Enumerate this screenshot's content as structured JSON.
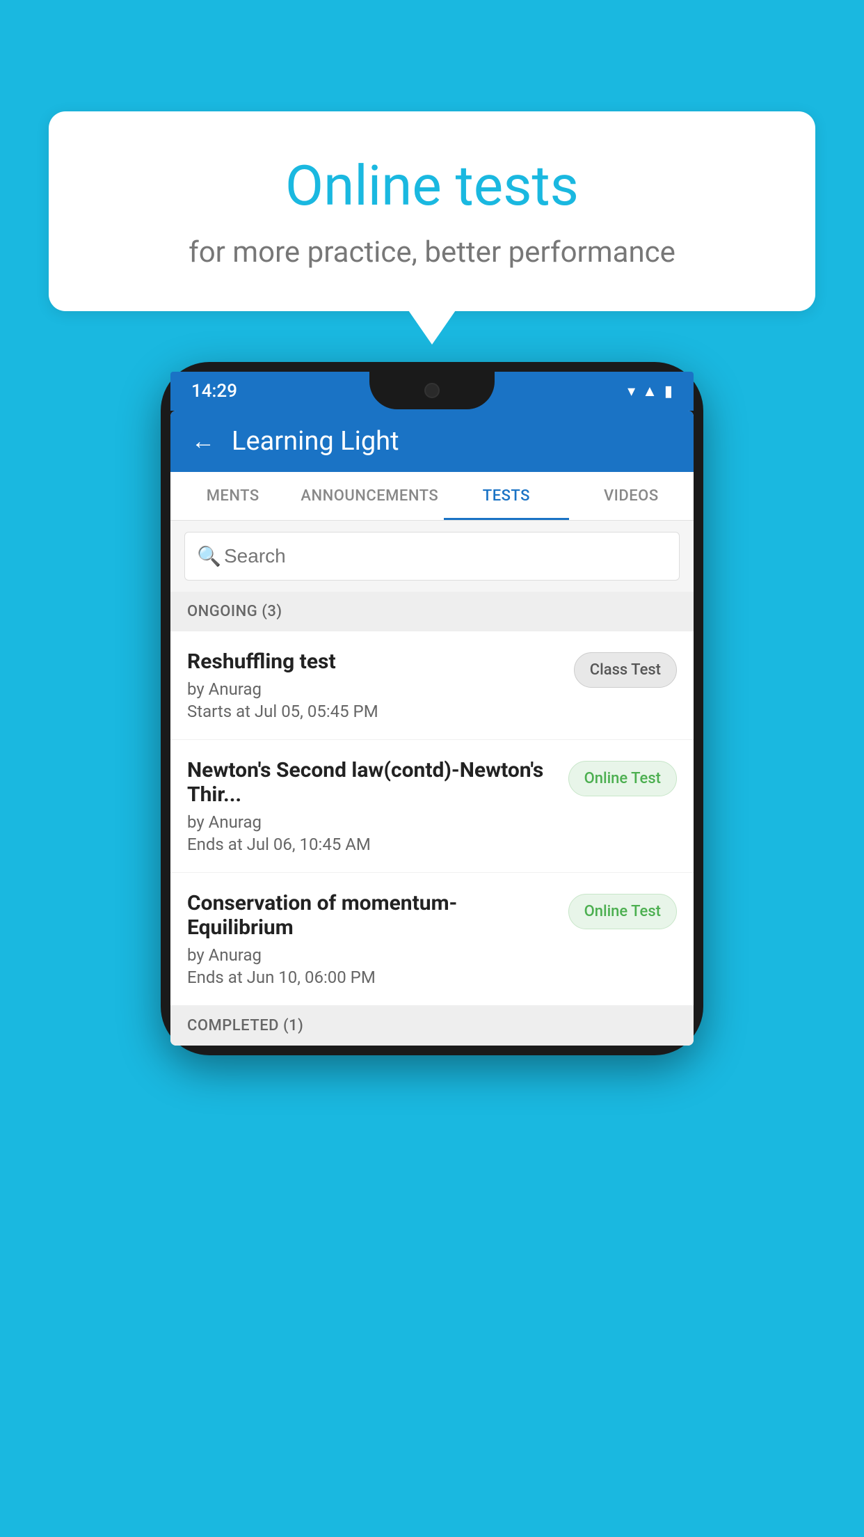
{
  "background": {
    "color": "#1ab8e0"
  },
  "speech_bubble": {
    "title": "Online tests",
    "subtitle": "for more practice, better performance"
  },
  "phone": {
    "status_bar": {
      "time": "14:29"
    },
    "app_header": {
      "title": "Learning Light",
      "back_label": "←"
    },
    "tabs": [
      {
        "label": "MENTS",
        "active": false
      },
      {
        "label": "ANNOUNCEMENTS",
        "active": false
      },
      {
        "label": "TESTS",
        "active": true
      },
      {
        "label": "VIDEOS",
        "active": false
      }
    ],
    "search": {
      "placeholder": "Search"
    },
    "ongoing_section": {
      "header": "ONGOING (3)",
      "tests": [
        {
          "name": "Reshuffling test",
          "by": "by Anurag",
          "time": "Starts at  Jul 05, 05:45 PM",
          "badge": "Class Test",
          "badge_type": "class"
        },
        {
          "name": "Newton's Second law(contd)-Newton's Thir...",
          "by": "by Anurag",
          "time": "Ends at  Jul 06, 10:45 AM",
          "badge": "Online Test",
          "badge_type": "online"
        },
        {
          "name": "Conservation of momentum-Equilibrium",
          "by": "by Anurag",
          "time": "Ends at  Jun 10, 06:00 PM",
          "badge": "Online Test",
          "badge_type": "online"
        }
      ]
    },
    "completed_section": {
      "header": "COMPLETED (1)"
    }
  }
}
